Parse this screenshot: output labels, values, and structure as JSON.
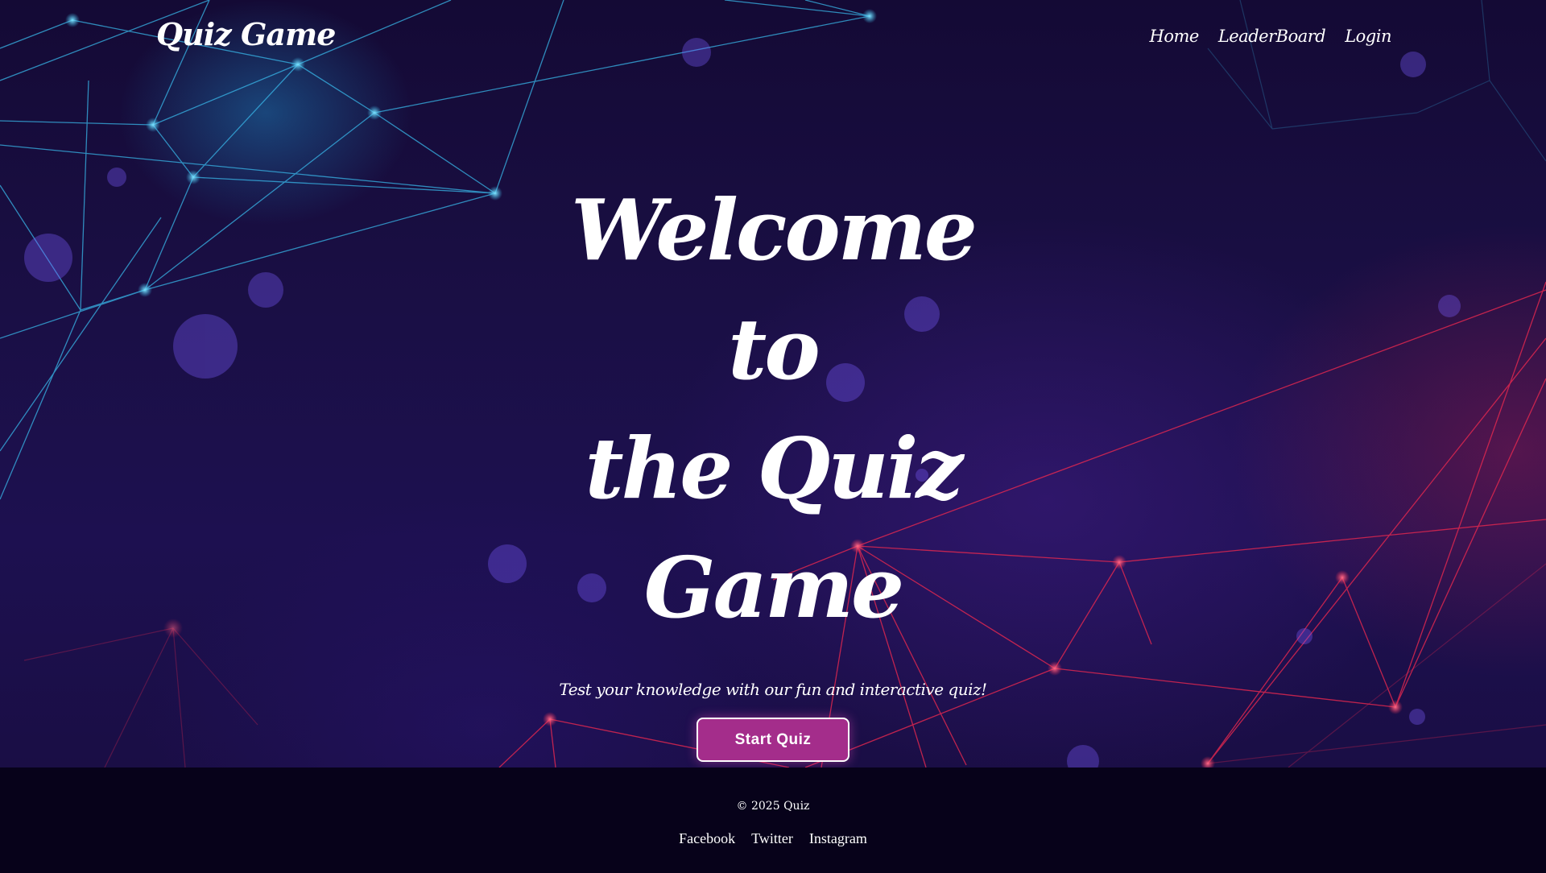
{
  "navbar": {
    "brand": "Quiz Game",
    "links": [
      "Home",
      "LeaderBoard",
      "Login"
    ]
  },
  "hero": {
    "title_lines": [
      "Welcome to",
      "the Quiz",
      "Game"
    ],
    "subtitle": "Test your knowledge with our fun and interactive quiz!",
    "start_button": "Start Quiz"
  },
  "footer": {
    "copyright": "© 2025 Quiz",
    "social": [
      "Facebook",
      "Twitter",
      "Instagram"
    ]
  },
  "colors": {
    "background_top": "#140a35",
    "background_bottom": "#1d1050",
    "button": "#a42d8b",
    "footer": "#07021a",
    "network_blue": "#38b6e8",
    "network_red": "#e8284f"
  }
}
